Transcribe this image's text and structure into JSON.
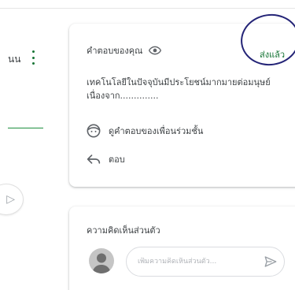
{
  "left_panel": {
    "label": "นน",
    "menu_icon": "more-vert-icon",
    "scroll_icon": "chevron-right-icon"
  },
  "answer_card": {
    "title": "คำตอบของคุณ",
    "visibility_icon": "eye-icon",
    "status": "ส่งแล้ว",
    "answer_text": "เทคโนโลยีในปัจจุบันมีประโยชน์มากมายต่อมนุษย์ เนื่องจาก..............",
    "classmates_icon": "face-icon",
    "classmates_label": "ดูคำตอบของเพื่อนร่วมชั้น",
    "reply_icon": "reply-icon",
    "reply_label": "ตอบ"
  },
  "comment_card": {
    "title": "ความคิดเห็นส่วนตัว",
    "avatar_icon": "avatar-icon",
    "input_placeholder": "เพิ่มความคิดเห็นส่วนตัว...",
    "input_value": "",
    "send_icon": "send-icon"
  },
  "colors": {
    "status_green": "#137333",
    "annotation_circle": "#242477",
    "divider_green": "#1e8e3e"
  }
}
